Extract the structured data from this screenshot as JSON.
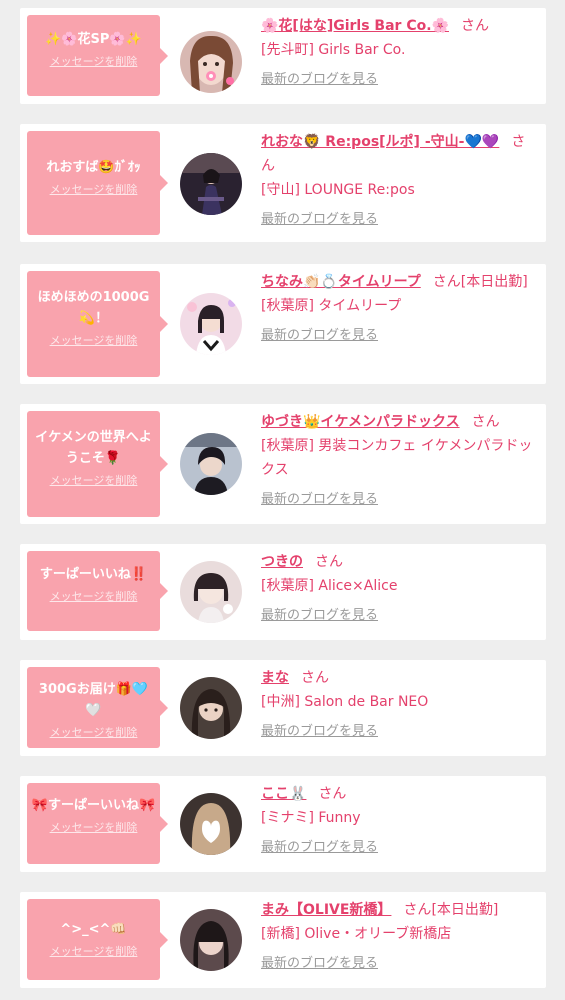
{
  "common": {
    "delete_label": "メッセージを削除",
    "blog_label": "最新のブログを見る",
    "san_label": "さん"
  },
  "items": [
    {
      "message": "✨🌸花SP🌸✨",
      "name": "🌸花[はな]Girls Bar Co.🌸",
      "suffix": "",
      "shop": "[先斗町] Girls Bar Co.",
      "avatar": "girl-with-pink-filter"
    },
    {
      "message": "れおすば🤩ｶﾞｵｯ",
      "name": "れおな🦁 Re:pos[ルポ] -守山-💙💜",
      "suffix": "",
      "shop": "[守山] LOUNGE Re:pos",
      "avatar": "woman-in-dress"
    },
    {
      "message": "ほめほめの1000G💫！",
      "name": "ちなみ👏🏻💍タイムリープ",
      "suffix": "[本日出勤]",
      "shop": "[秋葉原] タイムリープ",
      "avatar": "maid-cafe-girl"
    },
    {
      "message": "イケメンの世界へようこそ🌹",
      "name": "ゆづき👑イケメンパラドックス",
      "suffix": "",
      "shop": "[秋葉原] 男装コンカフェ イケメンパラドックス",
      "avatar": "dark-haired-host"
    },
    {
      "message": "すーぱーいいね‼️",
      "name": "つきの",
      "suffix": "",
      "shop": "[秋葉原] Alice×Alice",
      "avatar": "girl-with-bob-hair"
    },
    {
      "message": "300Gお届け🎁🩵🤍",
      "name": "まな",
      "suffix": "",
      "shop": "[中洲] Salon de Bar NEO",
      "avatar": "long-haired-woman"
    },
    {
      "message": "🎀すーぱーいいね🎀",
      "name": "ここ🐰",
      "suffix": "",
      "shop": "[ミナミ] Funny",
      "avatar": "woman-heart-cover"
    },
    {
      "message": "^>_<^👊🏻",
      "name": "まみ【OLIVE新橋】",
      "suffix": "[本日出勤]",
      "shop": "[新橋] Olive・オリーブ新橋店",
      "avatar": "woman-dark-bangs"
    }
  ],
  "colors": {
    "bubble": "#f9a3ad",
    "name": "#e4416c",
    "background": "#eeeeee"
  }
}
